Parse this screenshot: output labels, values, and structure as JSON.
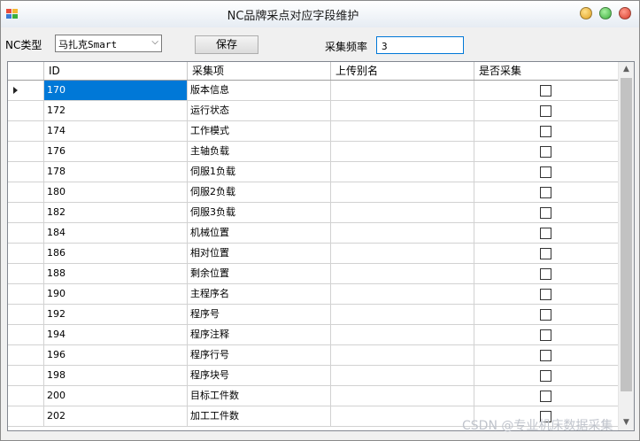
{
  "window": {
    "title": "NC品牌采点对应字段维护",
    "controls": {
      "minimize_color": "#e0a020",
      "maximize_color": "#3cae3c",
      "close_color": "#d83b2b"
    }
  },
  "toolbar": {
    "nc_type_label": "NC类型",
    "nc_type_value": "马扎克Smart",
    "save_label": "保存",
    "freq_label": "采集频率",
    "freq_value": "3"
  },
  "grid": {
    "columns": [
      "ID",
      "采集项",
      "上传别名",
      "是否采集"
    ],
    "selected_row": 0,
    "rows": [
      {
        "id": "170",
        "item": "版本信息",
        "alias": "",
        "collect": false
      },
      {
        "id": "172",
        "item": "运行状态",
        "alias": "",
        "collect": false
      },
      {
        "id": "174",
        "item": "工作模式",
        "alias": "",
        "collect": false
      },
      {
        "id": "176",
        "item": "主轴负载",
        "alias": "",
        "collect": false
      },
      {
        "id": "178",
        "item": "伺服1负载",
        "alias": "",
        "collect": false
      },
      {
        "id": "180",
        "item": "伺服2负载",
        "alias": "",
        "collect": false
      },
      {
        "id": "182",
        "item": "伺服3负载",
        "alias": "",
        "collect": false
      },
      {
        "id": "184",
        "item": "机械位置",
        "alias": "",
        "collect": false
      },
      {
        "id": "186",
        "item": "相对位置",
        "alias": "",
        "collect": false
      },
      {
        "id": "188",
        "item": "剩余位置",
        "alias": "",
        "collect": false
      },
      {
        "id": "190",
        "item": "主程序名",
        "alias": "",
        "collect": false
      },
      {
        "id": "192",
        "item": "程序号",
        "alias": "",
        "collect": false
      },
      {
        "id": "194",
        "item": "程序注释",
        "alias": "",
        "collect": false
      },
      {
        "id": "196",
        "item": "程序行号",
        "alias": "",
        "collect": false
      },
      {
        "id": "198",
        "item": "程序块号",
        "alias": "",
        "collect": false
      },
      {
        "id": "200",
        "item": "目标工件数",
        "alias": "",
        "collect": false
      },
      {
        "id": "202",
        "item": "加工工件数",
        "alias": "",
        "collect": false
      }
    ]
  },
  "watermark": "CSDN @专业机床数据采集"
}
